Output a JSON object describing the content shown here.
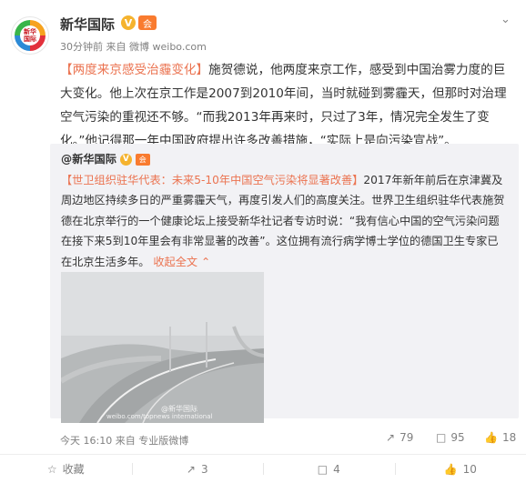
{
  "header": {
    "avatar_text": "新华\n国际",
    "username": "新华国际",
    "verified_mark": "V",
    "member_mark": "会",
    "time": "30分钟前",
    "source": "来自 微博 weibo.com"
  },
  "post": {
    "hashtag": "【两度来京感受治霾变化】",
    "text": "施贺德说，他两度来京工作，感受到中国治雾力度的巨大变化。他上次在京工作是2007到2010年间，当时就碰到雾霾天，但那时对治理空气污染的重视还不够。“而我2013年再来时，只过了3年，情况完全发生了变化。”他记得那一年中国政府提出许多改善措施，“实际上是向污染宣战”。"
  },
  "repost": {
    "user": "@新华国际",
    "verified_mark": "V",
    "member_mark": "会",
    "hashtag": "【世卫组织驻华代表：未来5-10年中国空气污染将显著改善】",
    "text": "2017年新年前后在京津冀及周边地区持续多日的严重雾霾天气，再度引发人们的高度关注。世界卫生组织驻华代表施贺德在北京举行的一个健康论坛上接受新华社记者专访时说：“我有信心中国的空气污染问题在接下来5到10年里会有非常显著的改善”。这位拥有流行病学博士学位的德国卫生专家已在北京生活多年。",
    "collapse_label": "收起全文",
    "collapse_icon": "chevron-up-icon",
    "photo_watermark": "@新华国际",
    "photo_caption": "weibo.com/topnews international",
    "time": "今天 16:10",
    "source": "来自 专业版微博",
    "stats": {
      "reposts": "79",
      "comments": "95",
      "likes": "18"
    }
  },
  "actions": {
    "favorite": "收藏",
    "repost": "3",
    "comment": "4",
    "like": "10"
  },
  "colors": {
    "accent": "#eb7350",
    "repost_bg": "#f2f2f5",
    "meta": "#808080"
  }
}
